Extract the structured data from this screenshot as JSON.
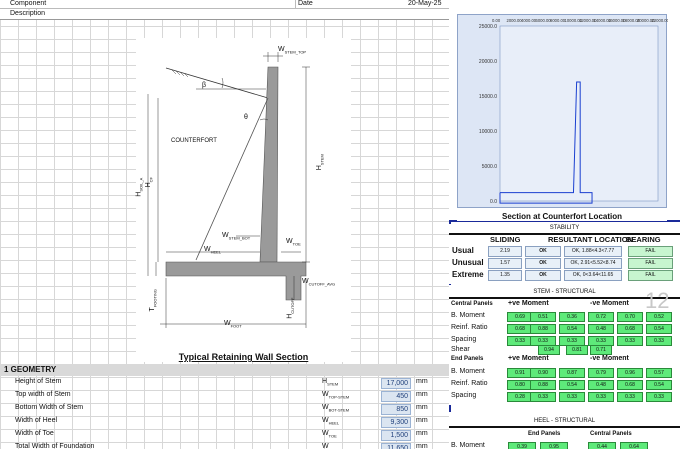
{
  "header": {
    "component_label": "Component",
    "description_label": "Description",
    "date_label": "Date",
    "date_value": "20-May-25"
  },
  "drawing": {
    "labels": {
      "w_stem_top": "W",
      "w_stem_top_sub": "STEM_TOP",
      "beta": "β",
      "theta": "θ",
      "counterfort": "COUNTERFORT",
      "h_stem": "H",
      "h_stem_sub": "STEM",
      "h_soil_a": "H",
      "h_soil_a_sub": "SOIL_A",
      "h_cf": "H",
      "h_cf_sub": "CF",
      "w_stem_bot": "W",
      "w_stem_bot_sub": "STEM_BOT",
      "w_toe": "W",
      "w_toe_sub": "TOE",
      "w_heel": "W",
      "w_heel_sub": "HEEL",
      "w_cutoff_avg": "W",
      "w_cutoff_avg_sub": "CUTOFF_AVG",
      "t_footing": "T",
      "t_footing_sub": "FOOTING",
      "h_cutoff": "H",
      "h_cutoff_sub": "CUTOFF",
      "w_foot": "W",
      "w_foot_sub": "FOOT"
    },
    "caption": "Typical Retaining Wall Section"
  },
  "geometry": {
    "title": "1  GEOMETRY",
    "rows": [
      {
        "label": "Height of Stem",
        "sym": "H",
        "sub": "STEM",
        "value": "17,000",
        "unit": "mm"
      },
      {
        "label": "Top width of Stem",
        "sym": "W",
        "sub": "TOP-STEM",
        "value": "450",
        "unit": "mm"
      },
      {
        "label": "Bottom Width of Stem",
        "sym": "W",
        "sub": "BOT-STEM",
        "value": "850",
        "unit": "mm"
      },
      {
        "label": "Width of Heel",
        "sym": "W",
        "sub": "HEEL",
        "value": "9,300",
        "unit": "mm"
      },
      {
        "label": "Width of Toe",
        "sym": "W",
        "sub": "TOE",
        "value": "1,500",
        "unit": "mm"
      },
      {
        "label": "Total Width of Foundation",
        "sym": "W",
        "sub": "",
        "value": "11,650",
        "unit": "mm"
      }
    ]
  },
  "chart_data": {
    "type": "line",
    "title": "Section at Counterfort Location",
    "top_ticks": [
      "0.00",
      "2000.00",
      "4000.00",
      "6000.00",
      "8000.00",
      "10000.00",
      "12000.00",
      "14000.00",
      "16000.00",
      "18000.00",
      "20000.00",
      "22000.00"
    ],
    "y_ticks": [
      "25000.0",
      "20000.0",
      "15000.0",
      "10000.0",
      "5000.0",
      "0.0"
    ],
    "ylim": [
      0,
      25000
    ],
    "xlim": [
      0,
      12000
    ],
    "series": [
      {
        "values": [
          [
            0,
            1200
          ],
          [
            0,
            -300
          ],
          [
            11650,
            -300
          ],
          [
            11650,
            1200
          ],
          [
            10150,
            1200
          ],
          [
            10150,
            17000
          ],
          [
            9700,
            17000
          ],
          [
            9300,
            1200
          ],
          [
            0,
            1200
          ]
        ]
      }
    ],
    "color": "#1a3fd0"
  },
  "stability": {
    "title": "STABILITY",
    "headers": [
      "SLIDING",
      "RESULTANT LOCATION",
      "BEARING"
    ],
    "rows": [
      {
        "label": "Usual",
        "sliding": "2.19",
        "slide_ok": "OK",
        "resultant": "OK, 1.88<4.3<7.77",
        "bearing": "FAIL"
      },
      {
        "label": "Unusual",
        "sliding": "1.57",
        "slide_ok": "OK",
        "resultant": "OK, 2.91<5.52<8.74",
        "bearing": "FAIL"
      },
      {
        "label": "Extreme",
        "sliding": "1.35",
        "slide_ok": "OK",
        "resultant": "OK, 0<3.64<11.65",
        "bearing": "FAIL"
      }
    ]
  },
  "stem": {
    "title": "STEM - STRUCTURAL",
    "central_label": "Central Panels",
    "pos_moment": "+ve Moment",
    "neg_moment": "-ve Moment",
    "rows": [
      {
        "label": "B. Moment",
        "values": [
          "0.69",
          "0.51",
          "0.36",
          "0.72",
          "0.70",
          "0.52"
        ]
      },
      {
        "label": "Reinf. Ratio",
        "values": [
          "0.68",
          "0.88",
          "0.54",
          "0.48",
          "0.68",
          "0.54"
        ]
      },
      {
        "label": "Spacing",
        "values": [
          "0.33",
          "0.33",
          "0.33",
          "0.33",
          "0.33",
          "0.33"
        ]
      }
    ],
    "shear_label": "Shear",
    "shear_values": [
      "0.94",
      "0.81",
      "0.71"
    ],
    "end_label": "End Panels",
    "end_rows": [
      {
        "label": "B. Moment",
        "values": [
          "0.91",
          "0.90",
          "0.87",
          "0.79",
          "0.96",
          "0.57"
        ]
      },
      {
        "label": "Reinf. Ratio",
        "values": [
          "0.80",
          "0.88",
          "0.54",
          "0.48",
          "0.68",
          "0.54"
        ]
      },
      {
        "label": "Spacing",
        "values": [
          "0.28",
          "0.33",
          "0.33",
          "0.33",
          "0.33",
          "0.33"
        ]
      }
    ],
    "watermark": "12"
  },
  "heel": {
    "title": "HEEL - STRUCTURAL",
    "end_label": "End Panels",
    "central_label": "Central Panels",
    "row_label": "B. Moment",
    "values": [
      "0.39",
      "0.95",
      "0.44",
      "0.64"
    ]
  }
}
